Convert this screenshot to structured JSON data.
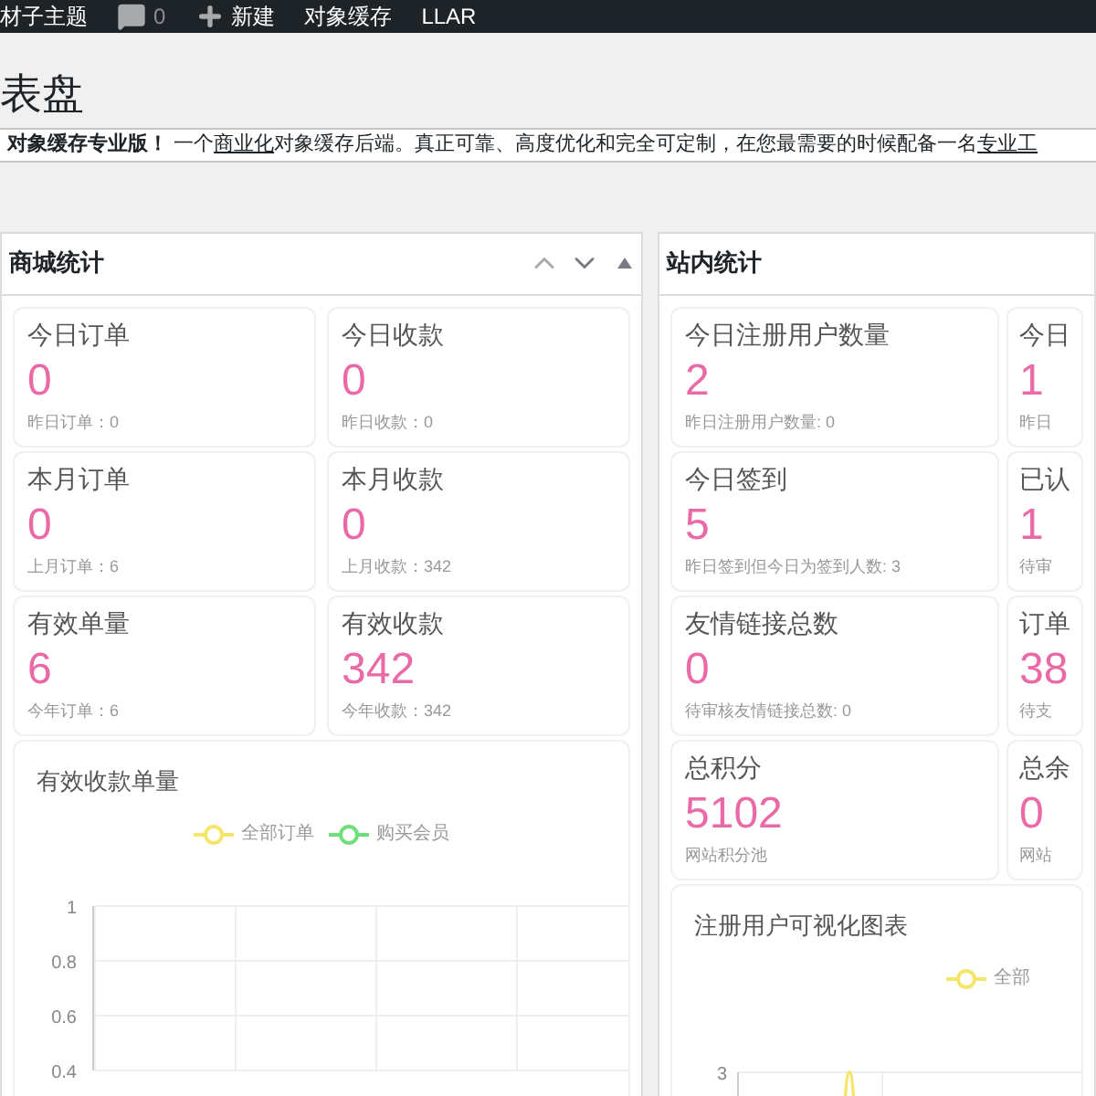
{
  "admin_bar": {
    "site": "材子主题",
    "comments": "0",
    "new": "新建",
    "items": [
      "对象缓存",
      "LLAR"
    ]
  },
  "page_title": "表盘",
  "notice": {
    "bold": "对象缓存专业版！",
    "text_1": " 一个",
    "link_1": "商业化",
    "text_2": "对象缓存后端。真正可靠、高度优化和完全可定制，在您最需要的时候配备一名",
    "link_2": "专业工"
  },
  "panels": [
    {
      "title": "商城统计",
      "controls": true,
      "cards": [
        {
          "title": "今日订单",
          "value": "0",
          "sub": "昨日订单：0"
        },
        {
          "title": "今日收款",
          "value": "0",
          "sub": "昨日收款：0"
        },
        {
          "title": "本月订单",
          "value": "0",
          "sub": "上月订单：6"
        },
        {
          "title": "本月收款",
          "value": "0",
          "sub": "上月收款：342"
        },
        {
          "title": "有效单量",
          "value": "6",
          "sub": "今年订单：6"
        },
        {
          "title": "有效收款",
          "value": "342",
          "sub": "今年收款：342"
        }
      ],
      "chart": {
        "title": "有效收款单量",
        "chart_data": {
          "type": "line",
          "ylim": [
            0.4,
            1
          ],
          "yticks": [
            0.4,
            0.6,
            0.8,
            1
          ],
          "series": [
            {
              "name": "全部订单",
              "color": "#f5e56b"
            },
            {
              "name": "购买会员",
              "color": "#6ee07a"
            }
          ]
        }
      }
    },
    {
      "title": "站内统计",
      "controls": false,
      "cards": [
        {
          "title": "今日注册用户数量",
          "value": "2",
          "sub": "昨日注册用户数量: 0"
        },
        {
          "title": "今日",
          "value": "1",
          "sub": "昨日"
        },
        {
          "title": "今日签到",
          "value": "5",
          "sub": "昨日签到但今日为签到人数: 3"
        },
        {
          "title": "已认",
          "value": "1",
          "sub": "待审"
        },
        {
          "title": "友情链接总数",
          "value": "0",
          "sub": "待审核友情链接总数: 0"
        },
        {
          "title": "订单",
          "value": "38",
          "sub": "待支"
        },
        {
          "title": "总积分",
          "value": "5102",
          "sub": "网站积分池"
        },
        {
          "title": "总余",
          "value": "0",
          "sub": "网站"
        }
      ],
      "chart": {
        "title": "注册用户可视化图表",
        "legend": [
          {
            "name": "全部",
            "color": "#f5e56b"
          }
        ],
        "axis_label": "3"
      }
    }
  ]
}
